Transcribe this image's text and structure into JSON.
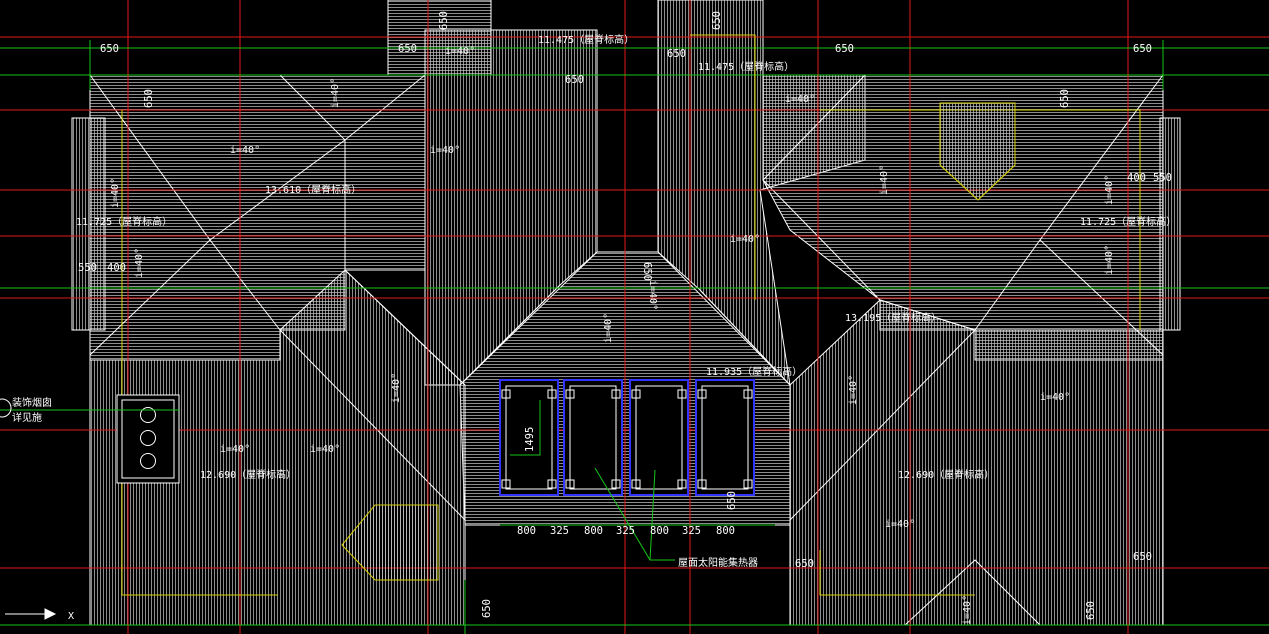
{
  "colors": {
    "background": "#000000",
    "roof_hatch": "#cfcfcf",
    "outline": "#ffffff",
    "axis": "#e01818",
    "level_leader": "#18c418",
    "wall_line": "#d6d000",
    "solar_frame": "#2f34ff"
  },
  "icons": {
    "ucs": "ucs-axis-icon",
    "chimney": "chimney-icon",
    "solar": "solar-panel-icon"
  },
  "annotations": {
    "chimney_note_1": "装饰烟囱",
    "chimney_note_2": "详见施",
    "ucs_label": "X",
    "solar_label": "屋面太阳能集热器",
    "slopes": [
      {
        "id": "s1",
        "text": "i=40°"
      },
      {
        "id": "s2",
        "text": "i=40°"
      },
      {
        "id": "s3",
        "text": "i=40°"
      },
      {
        "id": "s4",
        "text": "i=40°"
      },
      {
        "id": "s5",
        "text": "i=40°"
      },
      {
        "id": "s6",
        "text": "i=40°"
      },
      {
        "id": "s7",
        "text": "i=40°"
      },
      {
        "id": "s8",
        "text": "i=40°"
      },
      {
        "id": "s9",
        "text": "i=40°"
      },
      {
        "id": "s10",
        "text": "i=40°"
      },
      {
        "id": "s11",
        "text": "i=40°"
      },
      {
        "id": "s12",
        "text": "i=40°"
      },
      {
        "id": "s13",
        "text": "i=40°"
      },
      {
        "id": "s14",
        "text": "i=40°"
      },
      {
        "id": "s15",
        "text": "i=40°"
      },
      {
        "id": "s16",
        "text": "i=40°"
      },
      {
        "id": "s17",
        "text": "i=40°"
      },
      {
        "id": "s18",
        "text": "i=40°"
      },
      {
        "id": "s19",
        "text": "i=40°"
      },
      {
        "id": "s20",
        "text": "i=40°"
      }
    ],
    "levels": [
      {
        "id": "l1",
        "text": "11.475（屋脊标高）"
      },
      {
        "id": "l2",
        "text": "11.475（屋脊标高）"
      },
      {
        "id": "l3",
        "text": "13.610（屋脊标高）"
      },
      {
        "id": "l4",
        "text": "11.725（屋脊标高）"
      },
      {
        "id": "l5",
        "text": "11.725（屋脊标高）"
      },
      {
        "id": "l6",
        "text": "13.195（屋脊标高）"
      },
      {
        "id": "l7",
        "text": "11.935（屋脊标高）"
      },
      {
        "id": "l8",
        "text": "12.690（屋脊标高）"
      },
      {
        "id": "l9",
        "text": "12.690（屋脊标高）"
      }
    ],
    "dimensions": [
      {
        "id": "d1",
        "text": "650"
      },
      {
        "id": "d2",
        "text": "650"
      },
      {
        "id": "d3",
        "text": "650"
      },
      {
        "id": "d4",
        "text": "650"
      },
      {
        "id": "d5",
        "text": "650"
      },
      {
        "id": "d6",
        "text": "650"
      },
      {
        "id": "d7",
        "text": "650"
      },
      {
        "id": "d8",
        "text": "650"
      },
      {
        "id": "d9",
        "text": "650"
      },
      {
        "id": "d10",
        "text": "650"
      },
      {
        "id": "d11",
        "text": "550"
      },
      {
        "id": "d12",
        "text": "400"
      },
      {
        "id": "d13",
        "text": "400"
      },
      {
        "id": "d14",
        "text": "550"
      },
      {
        "id": "d15",
        "text": "650"
      },
      {
        "id": "d16",
        "text": "1495"
      },
      {
        "id": "d17",
        "text": "800"
      },
      {
        "id": "d18",
        "text": "325"
      },
      {
        "id": "d19",
        "text": "800"
      },
      {
        "id": "d20",
        "text": "325"
      },
      {
        "id": "d21",
        "text": "800"
      },
      {
        "id": "d22",
        "text": "325"
      },
      {
        "id": "d23",
        "text": "800"
      },
      {
        "id": "d24",
        "text": "650"
      },
      {
        "id": "d25",
        "text": "650"
      },
      {
        "id": "d26",
        "text": "650"
      },
      {
        "id": "d27",
        "text": "650"
      },
      {
        "id": "d28",
        "text": "650"
      }
    ]
  }
}
